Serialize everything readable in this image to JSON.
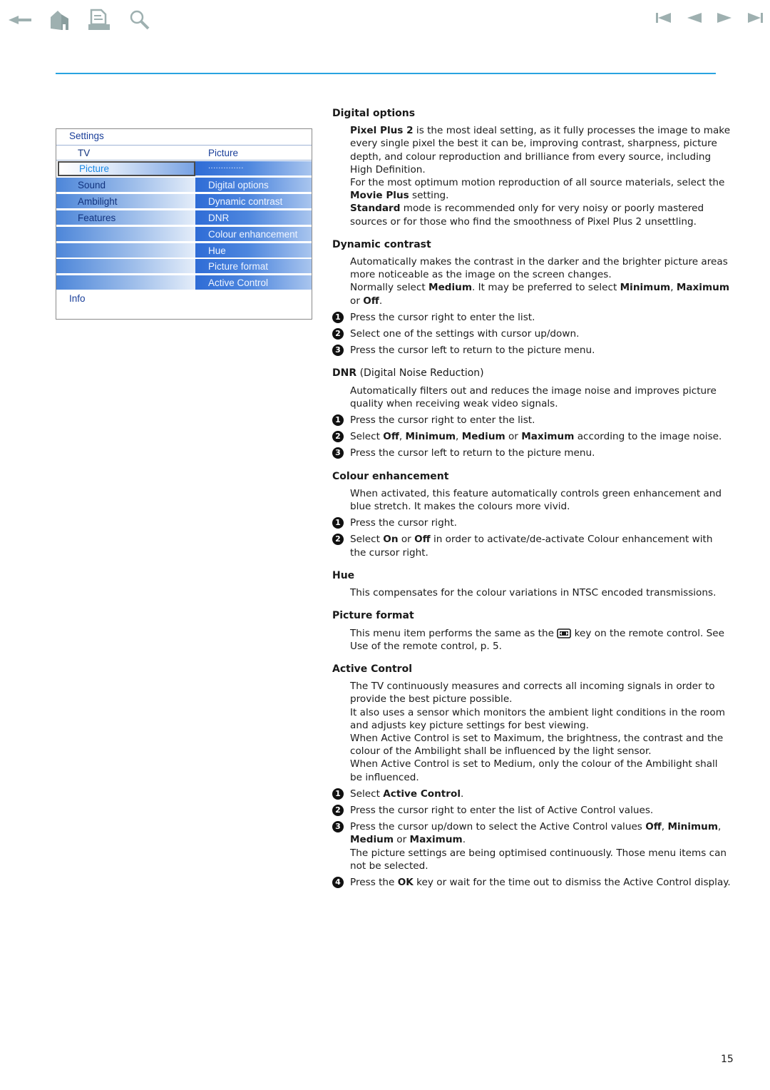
{
  "navigation": {
    "left_icons": [
      "back-arrow-icon",
      "home-icon",
      "print-icon",
      "search-icon"
    ],
    "right_icons": [
      "first-page-icon",
      "previous-page-icon",
      "next-page-icon",
      "last-page-icon"
    ],
    "icon_color": "#9eb0b0",
    "rule_color": "#29a3e0"
  },
  "menu": {
    "title": "Settings",
    "header_left": "TV",
    "header_right": "Picture",
    "rows": [
      {
        "left": "Picture",
        "right": "..............",
        "selected": true
      },
      {
        "left": "Sound",
        "right": "Digital options"
      },
      {
        "left": "Ambilight",
        "right": "Dynamic contrast"
      },
      {
        "left": "Features",
        "right": "DNR"
      },
      {
        "left": "",
        "right": "Colour enhancement"
      },
      {
        "left": "",
        "right": "Hue"
      },
      {
        "left": "",
        "right": "Picture format"
      },
      {
        "left": "",
        "right": "Active Control"
      }
    ],
    "info": "Info",
    "colors": {
      "selected_text": "#1b8ae6",
      "text_dark": "#12337e",
      "gradient_blue": "#2f6cd6"
    }
  },
  "sections": {
    "digital_options": {
      "heading": "Digital options",
      "p1_bold": "Pixel Plus 2",
      "p1_rest": " is the most ideal setting, as it fully processes the image to make every single pixel the best it can be, improving contrast, sharpness, picture depth, and colour reproduction and brilliance from every source, including High Definition.",
      "p2_start": "For the most optimum motion reproduction of all source materials, select the ",
      "p2_bold": "Movie Plus",
      "p2_end": " setting.",
      "p3_bold": "Standard",
      "p3_rest": " mode is recommended only for very noisy or poorly mastered sources or for those who find the smoothness of Pixel Plus 2 unsettling."
    },
    "dynamic_contrast": {
      "heading": "Dynamic contrast",
      "p1": "Automatically makes the contrast in the darker and the brighter picture areas more noticeable as the image on the screen changes.",
      "p2_a": "Normally select ",
      "p2_b": "Medium",
      "p2_c": ". It may be preferred to select ",
      "p2_d": "Minimum",
      "p2_e": ", ",
      "p2_f": "Maximum",
      "p2_g": " or ",
      "p2_h": "Off",
      "p2_i": ".",
      "steps": [
        "Press the cursor right to enter the list.",
        "Select one of the settings with cursor up/down.",
        "Press the cursor left to return to the picture menu."
      ]
    },
    "dnr": {
      "heading_bold": "DNR",
      "heading_rest": " (Digital Noise Reduction)",
      "p1": "Automatically filters out and reduces the image noise and improves picture quality when receiving weak video signals.",
      "step1": "Press the cursor right to enter the list.",
      "step2_a": "Select ",
      "step2_b": "Off",
      "step2_c": ", ",
      "step2_d": "Minimum",
      "step2_e": ", ",
      "step2_f": "Medium",
      "step2_g": " or ",
      "step2_h": "Maximum",
      "step2_i": " according to the image noise.",
      "step3": "Press the cursor left to return to the picture menu."
    },
    "colour_enhancement": {
      "heading": "Colour enhancement",
      "p1": "When activated, this feature automatically controls green enhancement and blue stretch. It makes the colours more vivid.",
      "step1": "Press the cursor right.",
      "step2_a": "Select ",
      "step2_b": "On",
      "step2_c": " or ",
      "step2_d": "Off",
      "step2_e": " in order to activate/de-activate Colour enhancement with the cursor right."
    },
    "hue": {
      "heading": "Hue",
      "p1": "This compensates for the colour variations in NTSC encoded transmissions."
    },
    "picture_format": {
      "heading": "Picture format",
      "p1_a": "This menu item performs the same as the ",
      "key_icon": "picture-format-key-icon",
      "p1_b": " key on the remote control. See Use of the remote control, p. 5."
    },
    "active_control": {
      "heading": "Active Control",
      "p1": "The TV continuously measures and corrects all incoming signals in order to provide the best picture possible.",
      "p2": "It also uses a sensor which monitors the ambient light conditions in the room and adjusts key picture settings for best viewing.",
      "p3": "When Active Control is set to Maximum, the brightness, the contrast and the colour of the Ambilight shall be influenced by the light sensor.",
      "p4": "When Active Control is set to Medium, only the colour of the Ambilight shall be influenced.",
      "step1_a": "Select ",
      "step1_b": "Active Control",
      "step1_c": ".",
      "step2": "Press the cursor right to enter the list of Active Control values.",
      "step3_a": "Press the cursor up/down to select the Active Control values ",
      "step3_b": "Off",
      "step3_c": ", ",
      "step3_d": "Minimum",
      "step3_e": ", ",
      "step3_f": "Medium",
      "step3_g": " or ",
      "step3_h": "Maximum",
      "step3_i": ".",
      "step3_note": "The picture settings are being optimised continuously. Those menu items can not be selected.",
      "step4_a": "Press the ",
      "step4_b": "OK",
      "step4_c": " key or wait for the time out to dismiss the Active Control display."
    }
  },
  "step_numbers": [
    "1",
    "2",
    "3",
    "4"
  ],
  "page_number": "15"
}
